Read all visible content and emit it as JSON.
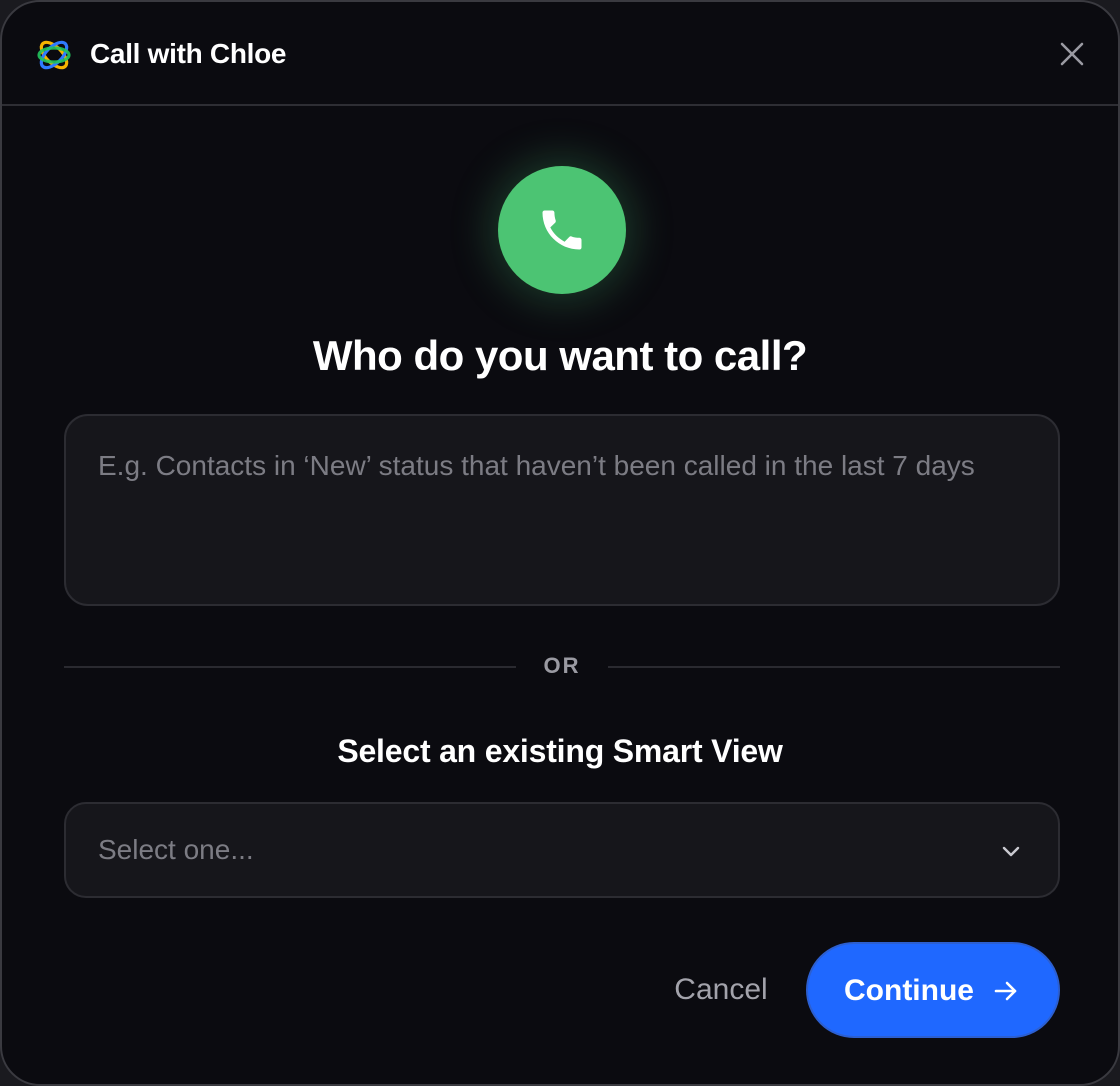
{
  "header": {
    "title": "Call with Chloe",
    "logo_icon": "chloe-logo-icon",
    "close_icon": "close-icon"
  },
  "hero": {
    "icon": "phone-icon",
    "accent": "#4cc473",
    "heading": "Who do you want to call?"
  },
  "query": {
    "value": "",
    "placeholder": "E.g. Contacts in ‘New’ status that haven’t been called in the last 7 days"
  },
  "divider": {
    "label": "OR"
  },
  "smart_view": {
    "heading": "Select an existing Smart View",
    "selected": "Select one...",
    "icon": "chevron-down-icon"
  },
  "footer": {
    "cancel_label": "Cancel",
    "continue_label": "Continue",
    "continue_icon": "arrow-right-icon",
    "primary": "#1f68ff"
  }
}
